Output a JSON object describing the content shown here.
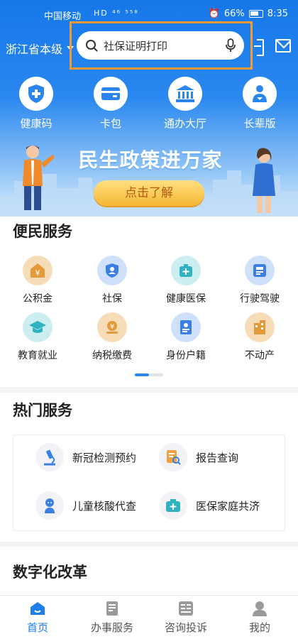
{
  "status_bar": {
    "carrier": "中国移动",
    "carrier_tags": "HD ⁴⁶ ⁵⁵⁸",
    "battery": "66%",
    "time": "8:35"
  },
  "header": {
    "region": "浙江省本级",
    "search_placeholder": "社保证明打印"
  },
  "quick_actions": [
    {
      "label": "健康码",
      "icon": "health-code-icon"
    },
    {
      "label": "卡包",
      "icon": "card-wallet-icon"
    },
    {
      "label": "通办大厅",
      "icon": "government-hall-icon"
    },
    {
      "label": "长辈版",
      "icon": "elder-mode-icon"
    }
  ],
  "banner": {
    "title": "民生政策进万家",
    "button": "点击了解"
  },
  "convenience": {
    "title": "便民服务",
    "items": [
      {
        "label": "公积金",
        "icon": "housing-fund-icon"
      },
      {
        "label": "社保",
        "icon": "social-security-icon"
      },
      {
        "label": "健康医保",
        "icon": "medical-insurance-icon"
      },
      {
        "label": "行驶驾驶",
        "icon": "driving-license-icon"
      },
      {
        "label": "教育就业",
        "icon": "education-cap-icon"
      },
      {
        "label": "纳税缴费",
        "icon": "tax-payment-icon"
      },
      {
        "label": "身份户籍",
        "icon": "id-card-icon"
      },
      {
        "label": "不动产",
        "icon": "real-estate-icon"
      }
    ]
  },
  "hot": {
    "title": "热门服务",
    "items": [
      {
        "label": "新冠检测预约",
        "icon": "microscope-icon"
      },
      {
        "label": "报告查询",
        "icon": "report-search-icon"
      },
      {
        "label": "儿童核酸代查",
        "icon": "child-icon"
      },
      {
        "label": "医保家庭共济",
        "icon": "medical-kit-icon"
      }
    ]
  },
  "digital_reform": {
    "title": "数字化改革"
  },
  "bottom_nav": [
    {
      "label": "首页",
      "icon": "home-icon",
      "active": true
    },
    {
      "label": "办事服务",
      "icon": "service-doc-icon",
      "active": false
    },
    {
      "label": "咨询投诉",
      "icon": "consult-icon",
      "active": false
    },
    {
      "label": "我的",
      "icon": "profile-icon",
      "active": false
    }
  ],
  "colors": {
    "primary": "#1e7fec",
    "highlight_frame": "#f39a35",
    "banner_button": "#f5b733"
  }
}
